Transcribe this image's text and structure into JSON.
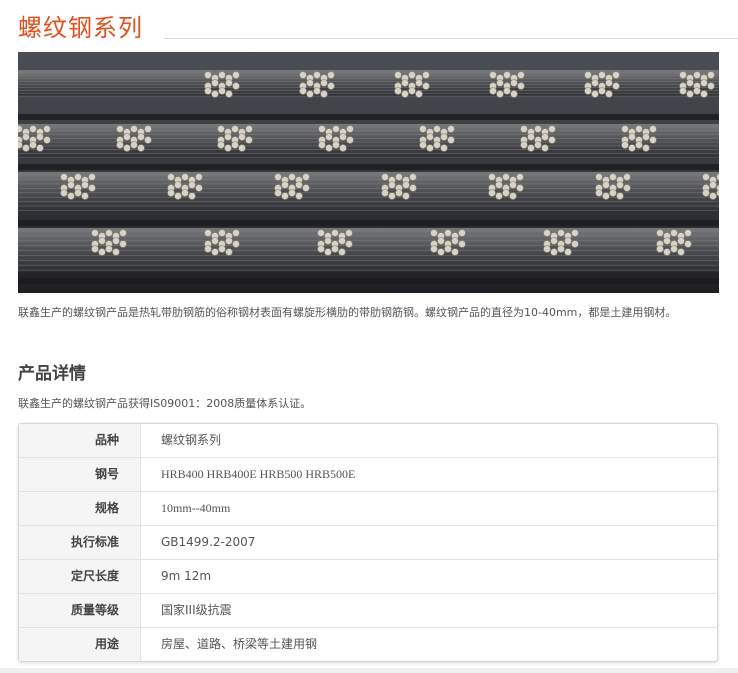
{
  "header": {
    "title": "螺纹钢系列"
  },
  "hero": {
    "image_name": "rebar-bundles-photo",
    "colors": {
      "background": "#2b2e33",
      "rod": "#5c5e60",
      "end": "#d9d2c6"
    }
  },
  "intro": {
    "text": "联鑫生产的螺纹钢产品是热轧带肋钢筋的俗称钢材表面有螺旋形横肋的带肋钢筋钢。螺纹钢产品的直径为10-40mm，都是土建用钢材。"
  },
  "details": {
    "section_title": "产品详情",
    "certification": "联鑫生产的螺纹钢产品获得IS09001：2008质量体系认证。",
    "rows": [
      {
        "label": "品种",
        "value": "螺纹钢系列"
      },
      {
        "label": "钢号",
        "value": " HRB400 HRB400E  HRB500  HRB500E"
      },
      {
        "label": "规格",
        "value": " 10mm--40mm"
      },
      {
        "label": "执行标准",
        "value": "GB1499.2-2007"
      },
      {
        "label": "定尺长度",
        "value": "9m  12m"
      },
      {
        "label": "质量等级",
        "value": "国家III级抗震"
      },
      {
        "label": "用途",
        "value": "房屋、道路、桥梁等土建用钢"
      }
    ]
  },
  "theme": {
    "accent": "#e2501f"
  }
}
